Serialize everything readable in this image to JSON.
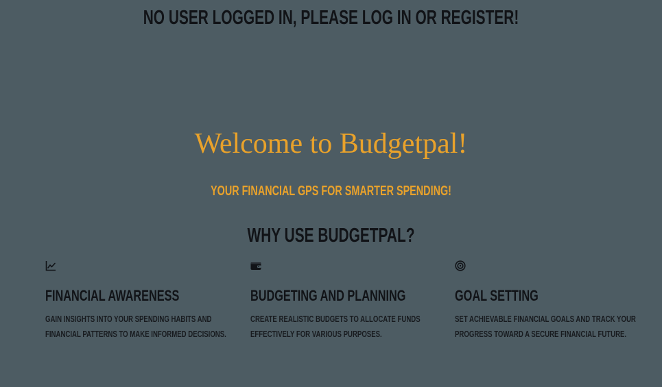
{
  "status_message": "NO USER LOGGED IN, PLEASE LOG IN OR REGISTER!",
  "hero": {
    "title": "Welcome to Budgetpal!",
    "tagline": "YOUR FINANCIAL GPS FOR SMARTER SPENDING!"
  },
  "why_section": {
    "heading": "WHY USE BUDGETPAL?",
    "features": [
      {
        "icon": "line-chart-icon",
        "title": "FINANCIAL AWARENESS",
        "description": "GAIN INSIGHTS INTO YOUR SPENDING HABITS AND FINANCIAL PATTERNS TO MAKE INFORMED DECISIONS."
      },
      {
        "icon": "wallet-icon",
        "title": "BUDGETING AND PLANNING",
        "description": "CREATE REALISTIC BUDGETS TO ALLOCATE FUNDS EFFECTIVELY FOR VARIOUS PURPOSES."
      },
      {
        "icon": "target-icon",
        "title": "GOAL SETTING",
        "description": "SET ACHIEVABLE FINANCIAL GOALS AND TRACK YOUR PROGRESS TOWARD A SECURE FINANCIAL FUTURE."
      }
    ]
  },
  "colors": {
    "background": "#4d5c63",
    "accent": "#e9a22b",
    "text": "#111317"
  }
}
